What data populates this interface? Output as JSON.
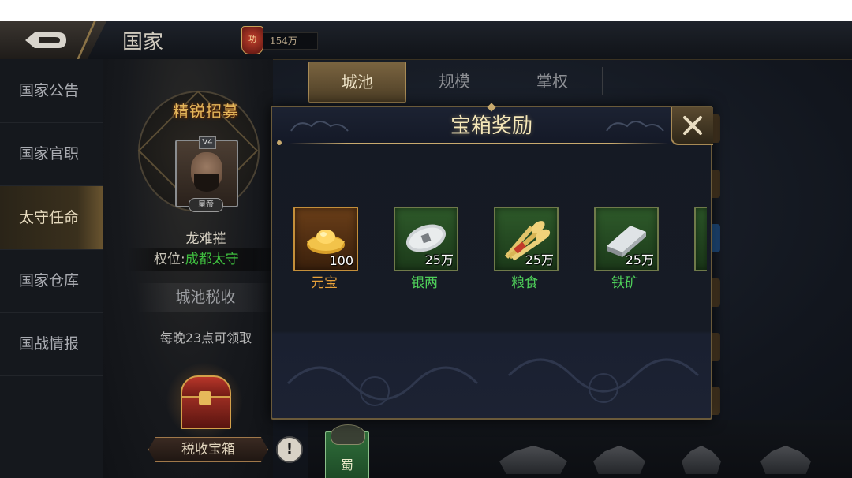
{
  "header": {
    "title": "国家",
    "merit_badge": "功",
    "merit_value": "154万"
  },
  "sidebar": {
    "items": [
      {
        "label": "国家公告"
      },
      {
        "label": "国家官职"
      },
      {
        "label": "太守任命"
      },
      {
        "label": "国家仓库"
      },
      {
        "label": "国战情报"
      }
    ],
    "active_index": 2
  },
  "governor": {
    "badge_title": "精锐招募",
    "level_tag": "V4",
    "title_tag": "皇帝",
    "name": "龙难摧",
    "rank_label": "权位:",
    "rank_value": "成都太守",
    "tax_title": "城池税收",
    "tax_time": "每晚23点可领取",
    "tax_chest_button": "税收宝箱",
    "info_button": "!"
  },
  "tabs": [
    {
      "label": "城池"
    },
    {
      "label": "规模"
    },
    {
      "label": "掌权"
    }
  ],
  "bottom": {
    "kingdom_banner": "蜀"
  },
  "modal": {
    "title": "宝箱奖励",
    "rewards": [
      {
        "name": "元宝",
        "qty": "100",
        "rarity": "gold",
        "icon": "gold-ingot-icon"
      },
      {
        "name": "银两",
        "qty": "25万",
        "rarity": "green",
        "icon": "silver-coin-icon"
      },
      {
        "name": "粮食",
        "qty": "25万",
        "rarity": "green",
        "icon": "grain-icon"
      },
      {
        "name": "铁矿",
        "qty": "25万",
        "rarity": "green",
        "icon": "iron-bar-icon"
      }
    ]
  },
  "colors": {
    "gold_text": "#e8a23a",
    "green_text": "#4fd05a",
    "rank_green": "#3fbf3f",
    "accent_gold": "#c8aa6e"
  }
}
